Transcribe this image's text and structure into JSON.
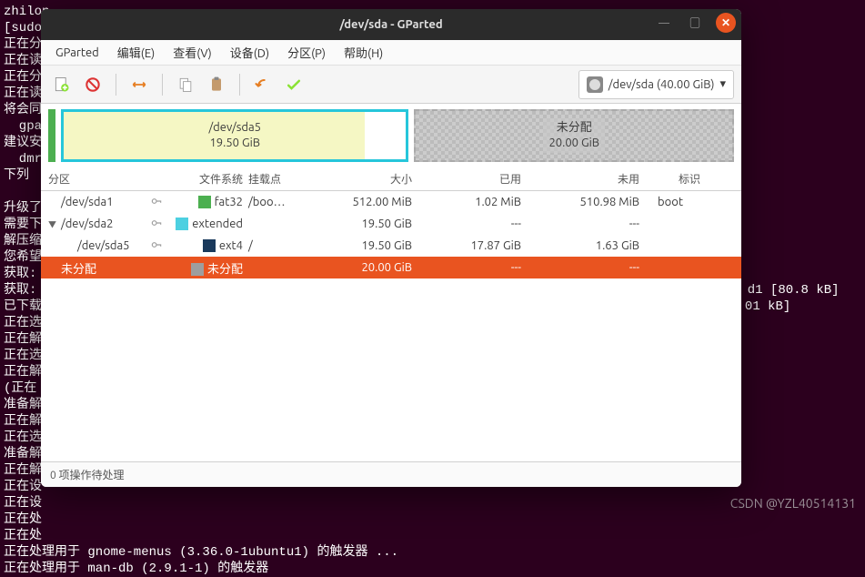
{
  "terminal_lines": "zhilon\n[sudo]\n正在分\n正在读\n正在分\n正在读\n将会同\n  gpa\n建议安\n  dmra\n下列\n\n升级了\n需要下\n解压缩\n您希望\n获取:\n获取:                                                                                             d1 [80.8 kB]\n已下载                                                                                            01 kB]\n正在选\n正在解\n正在选\n正在解\n(正在\n准备解\n正在解\n正在选\n准备解\n正在解\n正在设\n正在设\n正在处\n正在处\n正在处理用于 gnome-menus (3.36.0-1ubuntu1) 的触发器 ...\n正在处理用于 man-db (2.9.1-1) 的触发器",
  "watermark": "CSDN @YZL40514131",
  "title": "/dev/sda - GParted",
  "menu": [
    "GParted",
    "编辑(E)",
    "查看(V)",
    "设备(D)",
    "分区(P)",
    "帮助(H)"
  ],
  "device_selector": "/dev/sda  (40.00 GiB)",
  "viz": {
    "main": {
      "name": "/dev/sda5",
      "size": "19.50 GiB"
    },
    "unalloc": {
      "name": "未分配",
      "size": "20.00 GiB"
    }
  },
  "columns": {
    "part": "分区",
    "fs": "文件系统",
    "mount": "挂载点",
    "size": "大小",
    "used": "已用",
    "unused": "未用",
    "flag": "标识"
  },
  "rows": [
    {
      "indent": 0,
      "name": "/dev/sda1",
      "key": true,
      "fs": "fat32",
      "fsclass": "sw-fat32",
      "mount": "/boo…",
      "size": "512.00 MiB",
      "used": "1.02 MiB",
      "unused": "510.98 MiB",
      "flag": "boot",
      "tri": ""
    },
    {
      "indent": 0,
      "name": "/dev/sda2",
      "key": true,
      "fs": "extended",
      "fsclass": "sw-ext",
      "mount": "",
      "size": "19.50 GiB",
      "used": "---",
      "unused": "---",
      "flag": "",
      "tri": "▼"
    },
    {
      "indent": 1,
      "name": "/dev/sda5",
      "key": true,
      "fs": "ext4",
      "fsclass": "sw-ext4",
      "mount": "/",
      "size": "19.50 GiB",
      "used": "17.87 GiB",
      "unused": "1.63 GiB",
      "flag": "",
      "tri": ""
    },
    {
      "indent": 0,
      "name": "未分配",
      "key": false,
      "fs": "未分配",
      "fsclass": "sw-unalloc",
      "mount": "",
      "size": "20.00 GiB",
      "used": "---",
      "unused": "---",
      "flag": "",
      "tri": "",
      "selected": true
    }
  ],
  "status": "0 项操作待处理"
}
